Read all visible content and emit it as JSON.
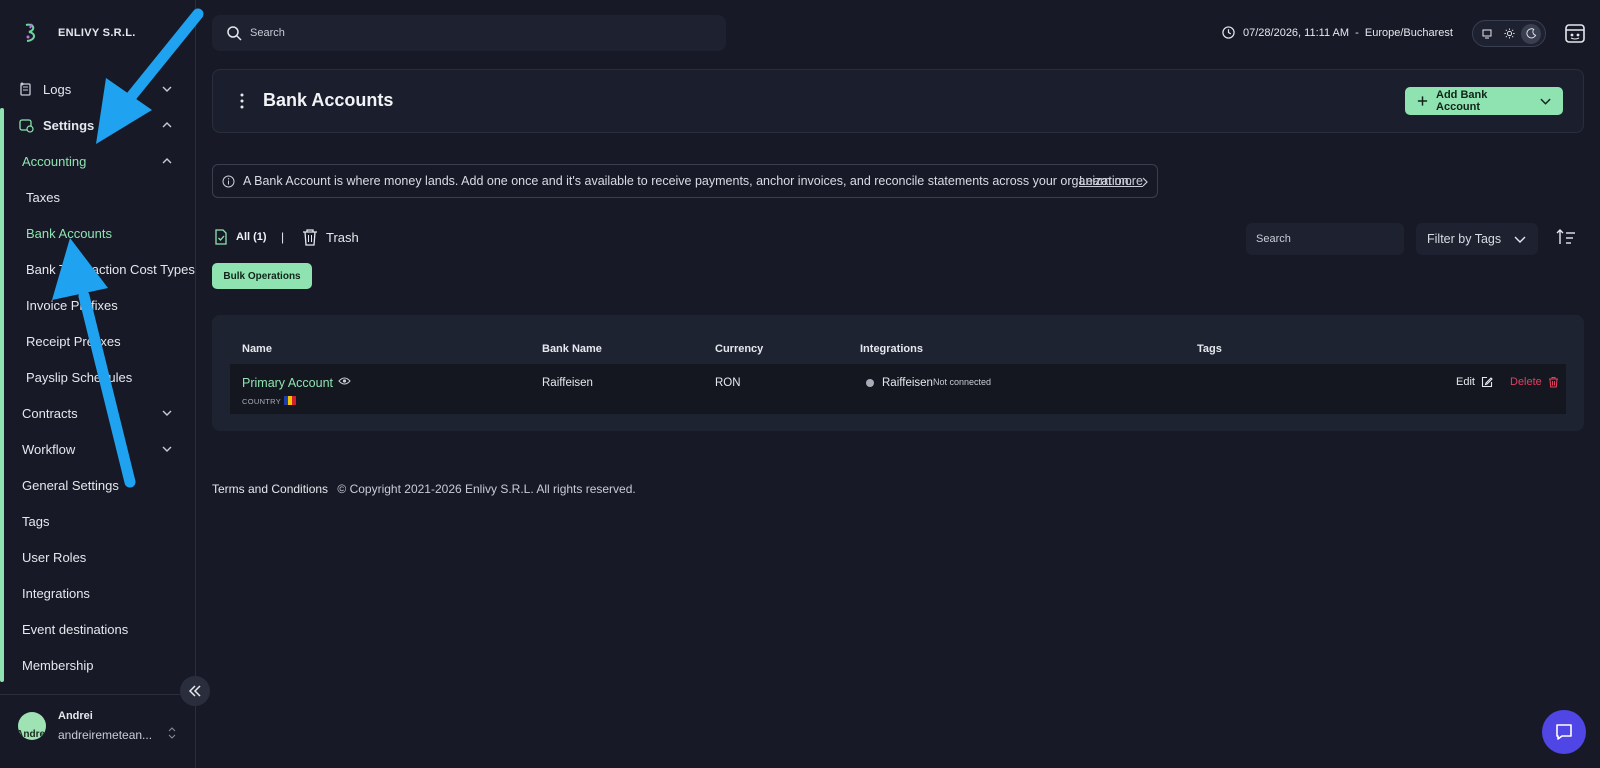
{
  "app": {
    "org_name": "ENLIVY S.R.L."
  },
  "topbar": {
    "search_placeholder": "Search",
    "datetime": "07/28/2026, 11:11 AM  -  Europe/Bucharest"
  },
  "sidebar": {
    "items": [
      {
        "label": "Logs"
      },
      {
        "label": "Settings"
      },
      {
        "label": "Accounting"
      },
      {
        "label": "Taxes"
      },
      {
        "label": "Bank Accounts"
      },
      {
        "label": "Bank Transaction Cost Types"
      },
      {
        "label": "Invoice Prefixes"
      },
      {
        "label": "Receipt Prefixes"
      },
      {
        "label": "Payslip Schedules"
      },
      {
        "label": "Contracts"
      },
      {
        "label": "Workflow"
      },
      {
        "label": "General Settings"
      },
      {
        "label": "Tags"
      },
      {
        "label": "User Roles"
      },
      {
        "label": "Integrations"
      },
      {
        "label": "Event destinations"
      },
      {
        "label": "Membership"
      }
    ],
    "user": {
      "avatar_text": "Andrei",
      "name": "Andrei",
      "email": "andreiremetean..."
    }
  },
  "page": {
    "title": "Bank Accounts",
    "add_button": "Add Bank Account",
    "info_text": "A Bank Account is where money lands. Add one once and it's available to receive payments, anchor invoices, and reconcile statements across your organization.",
    "learn_more": "Learn more",
    "tab_all": "All (1)",
    "tab_separator": "|",
    "tab_trash": "Trash",
    "filter_search_placeholder": "Search",
    "filter_tags": "Filter by Tags",
    "bulk_operations": "Bulk Operations"
  },
  "table": {
    "headers": [
      "Name",
      "Bank Name",
      "Currency",
      "Integrations",
      "Tags"
    ],
    "rows": [
      {
        "name": "Primary Account",
        "country_label": "COUNTRY",
        "bank_name": "Raiffeisen",
        "currency": "RON",
        "integration": "Raiffeisen",
        "integration_status": "Not connected",
        "edit": "Edit",
        "delete": "Delete"
      }
    ]
  },
  "footer": {
    "terms": "Terms and Conditions",
    "copyright": "© Copyright 2021-2026 Enlivy S.R.L. All rights reserved."
  },
  "colors": {
    "accent": "#8fe3b0",
    "background": "#171a26",
    "danger": "#e0405e",
    "chat": "#4f46e5",
    "annotation_arrow": "#1fa3f0"
  },
  "icons": [
    "logo-icon",
    "logs-icon",
    "settings-icon",
    "chevron-down-icon",
    "chevron-up-icon",
    "search-icon",
    "clock-icon",
    "monitor-icon",
    "sun-icon",
    "moon-icon",
    "calendar-icon",
    "kebab-icon",
    "plus-icon",
    "info-icon",
    "chevron-right-icon",
    "file-check-icon",
    "trash-icon",
    "sort-icon",
    "eye-icon",
    "flag-romania-icon",
    "edit-icon",
    "delete-icon",
    "collapse-icon",
    "chat-icon"
  ]
}
